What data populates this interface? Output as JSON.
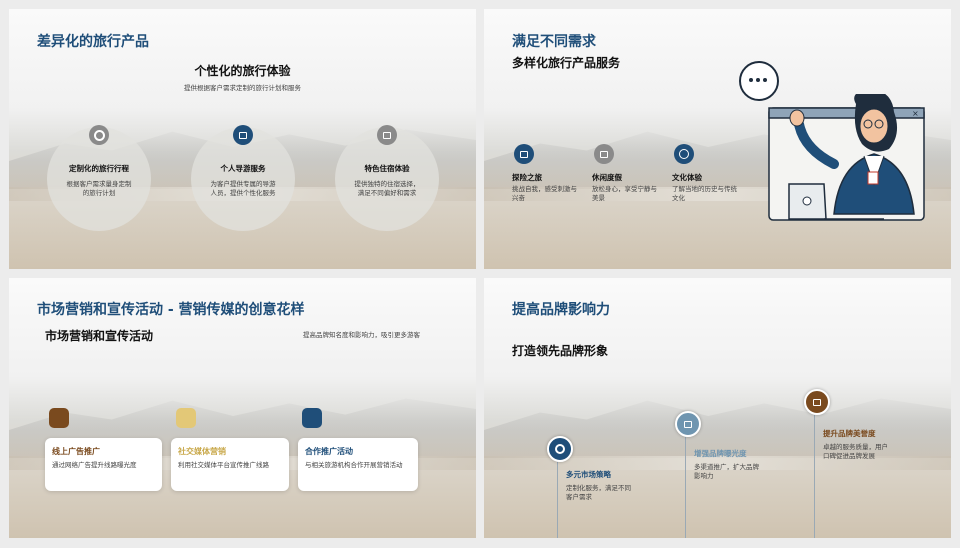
{
  "slide1": {
    "title": "差异化的旅行产品",
    "heading": "个性化的旅行体验",
    "subtitle": "提供根据客户需求定制的旅行计划和服务",
    "items": [
      {
        "title": "定制化的旅行行程",
        "line1": "根据客户需求量身定制",
        "line2": "的旅行计划"
      },
      {
        "title": "个人导游服务",
        "line1": "为客户提供专属的导游",
        "line2": "人员，提供个性化服务"
      },
      {
        "title": "特色住宿体验",
        "line1": "提供独特的住宿选择，",
        "line2": "满足不同偏好和需求"
      }
    ]
  },
  "slide2": {
    "title": "满足不同需求",
    "heading": "多样化旅行产品服务",
    "items": [
      {
        "title": "探险之旅",
        "line1": "挑战自我，感受刺激与",
        "line2": "兴奋"
      },
      {
        "title": "休闲度假",
        "line1": "放松身心，享受宁静与",
        "line2": "美景"
      },
      {
        "title": "文化体验",
        "line1": "了解当地的历史与传统",
        "line2": "文化"
      }
    ]
  },
  "slide3": {
    "title": "市场营销和宣传活动 - 营销传媒的创意花样",
    "heading": "市场营销和宣传活动",
    "note": "提高品牌知名度和影响力，吸引更多游客",
    "cards": [
      {
        "title": "线上广告推广",
        "desc": "通过网络广告提升线路曝光度",
        "color": "#7a4a1e"
      },
      {
        "title": "社交媒体营销",
        "desc": "利用社交媒体平台宣传推广线路",
        "color": "#e3c877"
      },
      {
        "title": "合作推广活动",
        "desc": "与相关旅游机构合作开展营销活动",
        "color": "#1f4e79"
      }
    ]
  },
  "slide4": {
    "title": "提高品牌影响力",
    "heading": "打造领先品牌形象",
    "items": [
      {
        "title": "多元市场策略",
        "line1": "定制化服务，满足不同",
        "line2": "客户需求",
        "color": "#1f4e79"
      },
      {
        "title": "增强品牌曝光度",
        "line1": "多渠道推广，扩大品牌",
        "line2": "影响力",
        "color": "#6f95b0"
      },
      {
        "title": "提升品牌美誉度",
        "line1": "卓越的服务质量，用户",
        "line2": "口碑促进品牌发展",
        "color": "#7a4a1e"
      }
    ]
  },
  "colors": {
    "primary": "#1f4e79",
    "brown": "#7a4a1e",
    "gray": "#8a8a8a"
  },
  "icons": [
    "disc-icon",
    "image-icon",
    "briefcase-icon",
    "palette-icon",
    "clipboard-icon",
    "globe-icon",
    "folder-icon",
    "document-icon",
    "sitemap-icon"
  ]
}
